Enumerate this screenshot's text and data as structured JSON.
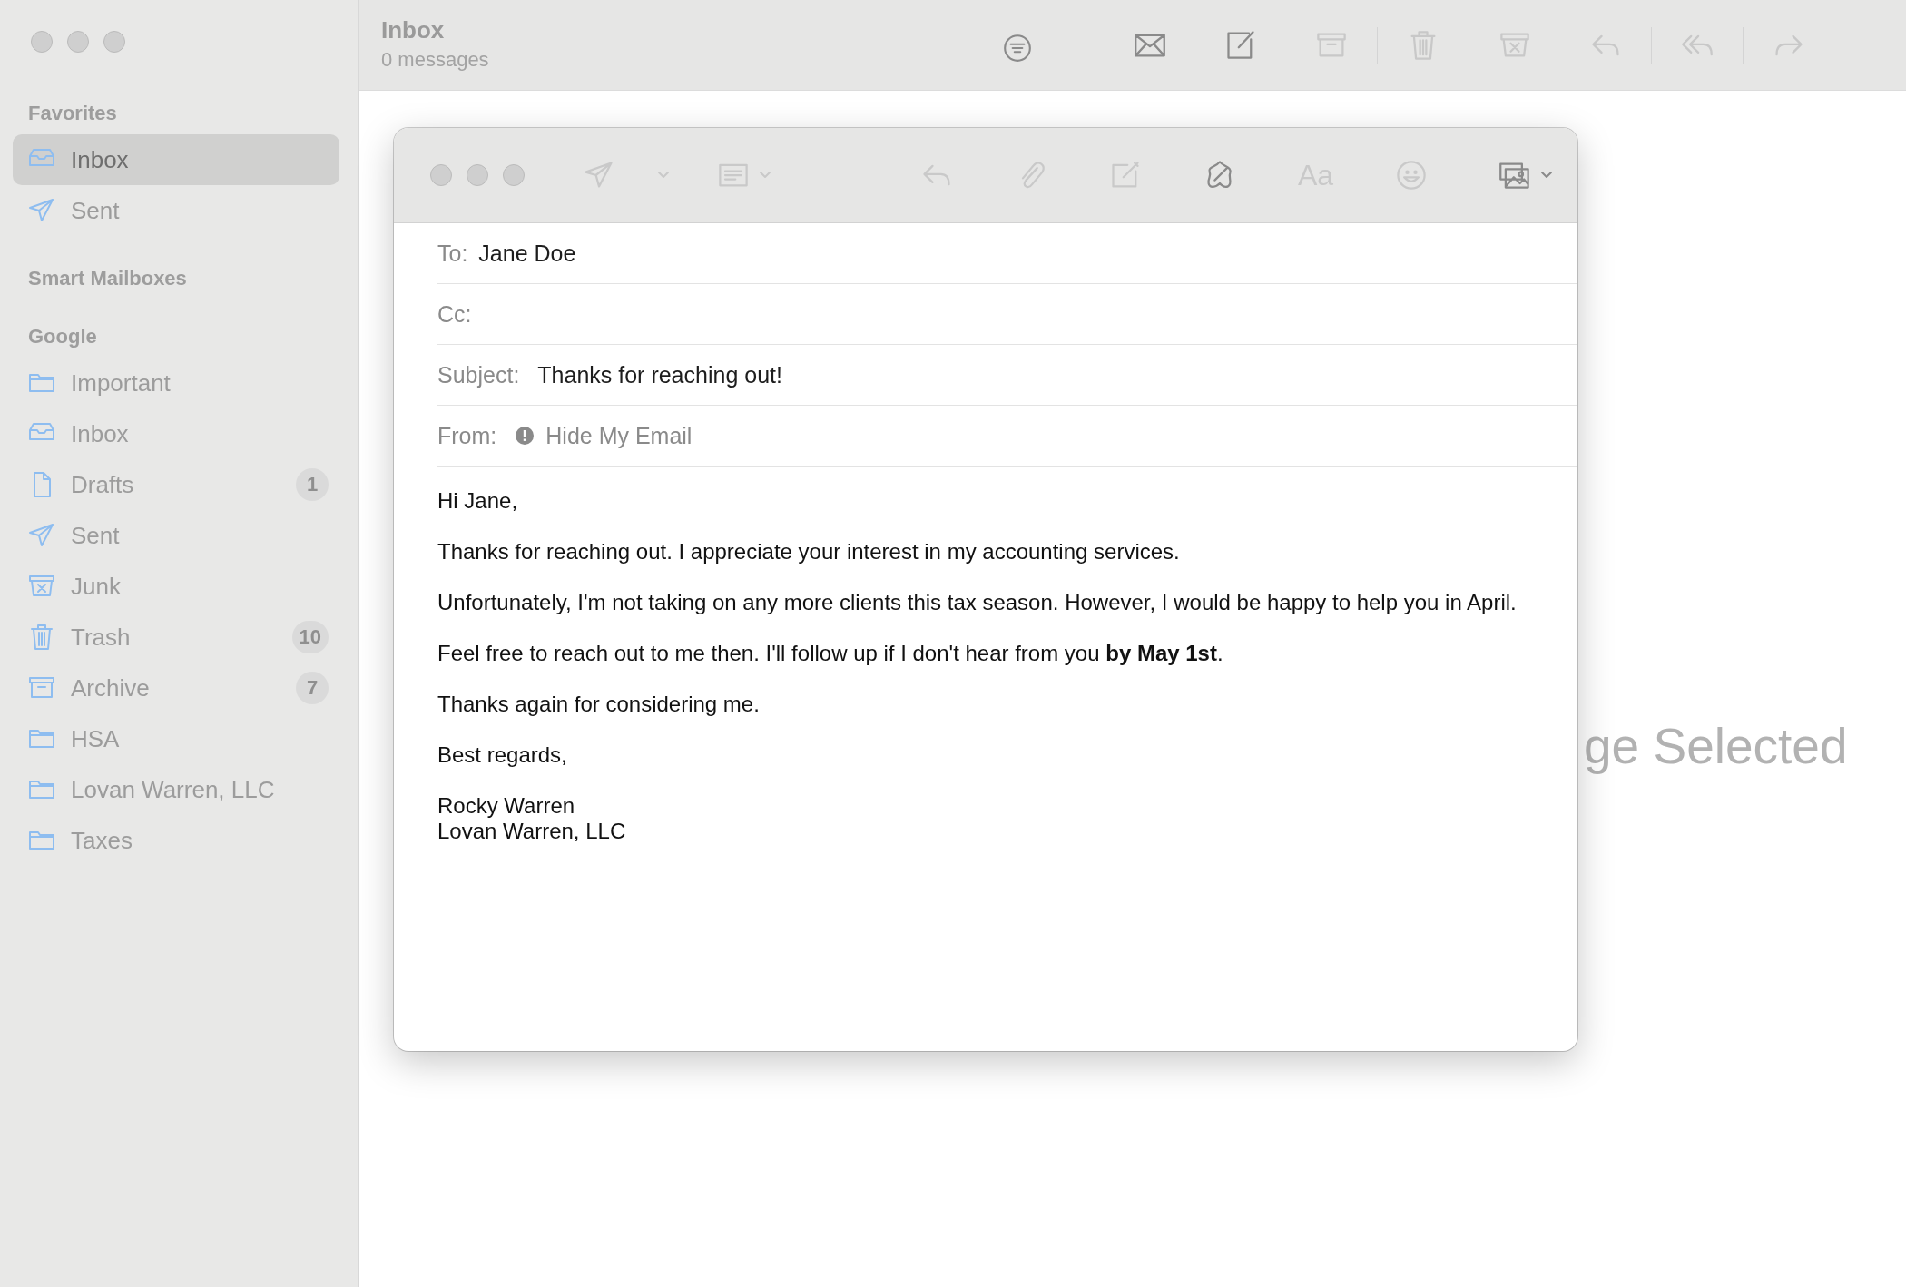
{
  "sidebar": {
    "sections": [
      {
        "title": "Favorites",
        "items": [
          {
            "label": "Inbox",
            "kind": "inbox",
            "selected": true
          },
          {
            "label": "Sent",
            "kind": "sent",
            "selected": false
          }
        ]
      },
      {
        "title": "Smart Mailboxes"
      },
      {
        "title": "Google",
        "items": [
          {
            "label": "Important",
            "kind": "folder",
            "selected": false
          },
          {
            "label": "Inbox",
            "kind": "inbox",
            "selected": false
          },
          {
            "label": "Drafts",
            "kind": "drafts",
            "selected": false,
            "badge": "1"
          },
          {
            "label": "Sent",
            "kind": "sent",
            "selected": false
          },
          {
            "label": "Junk",
            "kind": "junk",
            "selected": false
          },
          {
            "label": "Trash",
            "kind": "trash",
            "selected": false,
            "badge": "10"
          },
          {
            "label": "Archive",
            "kind": "archive",
            "selected": false,
            "badge": "7"
          },
          {
            "label": "HSA",
            "kind": "folder",
            "selected": false
          },
          {
            "label": "Lovan Warren, LLC",
            "kind": "folder",
            "selected": false
          },
          {
            "label": "Taxes",
            "kind": "folder",
            "selected": false
          }
        ]
      }
    ]
  },
  "message_list": {
    "title": "Inbox",
    "subtitle": "0 messages"
  },
  "toolbar": [
    {
      "kind": "envelope",
      "disabled": false
    },
    {
      "kind": "compose",
      "disabled": false
    },
    {
      "kind": "archive",
      "disabled": true
    },
    {
      "kind": "trash",
      "disabled": true
    },
    {
      "kind": "junk",
      "disabled": true
    },
    {
      "kind": "reply",
      "disabled": true
    },
    {
      "kind": "reply-all",
      "disabled": true
    },
    {
      "kind": "forward",
      "disabled": true
    }
  ],
  "viewer": {
    "empty_text": "ge Selected"
  },
  "compose": {
    "toolbar": [
      {
        "kind": "send",
        "disabled": true
      },
      {
        "kind": "header",
        "disabled": true
      },
      {
        "kind": "reply",
        "disabled": true
      },
      {
        "kind": "attach",
        "disabled": true
      },
      {
        "kind": "markup",
        "disabled": true
      },
      {
        "kind": "writing",
        "disabled": false
      },
      {
        "kind": "font",
        "label": "Aa",
        "disabled": true
      },
      {
        "kind": "emoji",
        "disabled": true
      },
      {
        "kind": "photo",
        "disabled": false
      }
    ],
    "fields": [
      {
        "label": "To:",
        "value": "Jane Doe"
      },
      {
        "label": "Cc:"
      },
      {
        "label": "Subject:",
        "value": "Thanks for reaching out!"
      },
      {
        "label": "From:",
        "value": "Hide My Email",
        "alert": true
      }
    ],
    "body": [
      [
        "Hi Jane,"
      ],
      [
        "Thanks for reaching out. I appreciate your interest in my accounting services."
      ],
      [
        "Unfortunately, I'm not taking on any more clients this tax season. However, I would be happy to help you in April."
      ],
      [
        "Feel free to reach out to me then. I'll follow up if I don't hear from you **by May 1st**."
      ],
      [
        "Thanks again for considering me."
      ],
      [
        "Best regards,"
      ],
      [
        "Rocky Warren",
        "Lovan Warren, LLC"
      ]
    ]
  }
}
